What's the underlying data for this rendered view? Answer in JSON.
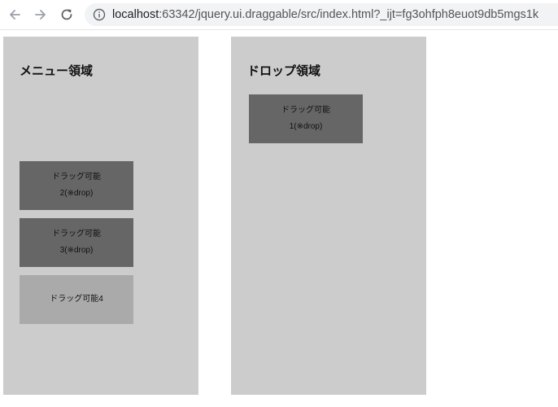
{
  "browser": {
    "url_host": "localhost",
    "url_rest": ":63342/jquery.ui.draggable/src/index.html?_ijt=fg3ohfph8euot9db5mgs1k"
  },
  "menu_panel": {
    "title": "メニュー領域",
    "items": [
      {
        "line1": "ドラッグ可能",
        "line2": "2(※drop)",
        "state": "dropped"
      },
      {
        "line1": "ドラッグ可能",
        "line2": "3(※drop)",
        "state": "dropped"
      },
      {
        "line1": "ドラッグ可能4",
        "line2": "",
        "state": "normal"
      }
    ]
  },
  "drop_panel": {
    "title": "ドロップ領域",
    "items": [
      {
        "line1": "ドラッグ可能",
        "line2": "1(※drop)",
        "state": "dropped"
      }
    ]
  },
  "colors": {
    "panel_bg": "#cccccc",
    "item_dropped_bg": "#666666",
    "item_normal_bg": "#aaaaaa"
  },
  "icons": [
    "back-arrow-icon",
    "forward-arrow-icon",
    "reload-icon",
    "info-icon"
  ]
}
